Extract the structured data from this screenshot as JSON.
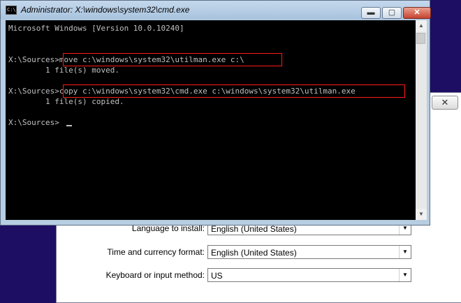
{
  "setup_dialog": {
    "close_label": "✕",
    "rows": [
      {
        "label": "Language to install:",
        "value": "English (United States)"
      },
      {
        "label": "Time and currency format:",
        "value": "English (United States)"
      },
      {
        "label": "Keyboard or input method:",
        "value": "US"
      }
    ]
  },
  "cmd": {
    "title": "Administrator: X:\\windows\\system32\\cmd.exe",
    "icon_text": "C:\\",
    "buttons": {
      "minimize": "▬",
      "maximize": "▢",
      "close": "✕"
    },
    "lines": [
      "Microsoft Windows [Version 10.0.10240]",
      "",
      "",
      "X:\\Sources>move c:\\windows\\system32\\utilman.exe c:\\",
      "        1 file(s) moved.",
      "",
      "X:\\Sources>copy c:\\windows\\system32\\cmd.exe c:\\windows\\system32\\utilman.exe",
      "        1 file(s) copied.",
      "",
      "X:\\Sources>"
    ]
  },
  "scrollbar": {
    "up": "▲",
    "down": "▼"
  },
  "colors": {
    "highlight": "#ff1a1a",
    "desktop": "#1d0d63",
    "console_text": "#c0c0c0"
  }
}
